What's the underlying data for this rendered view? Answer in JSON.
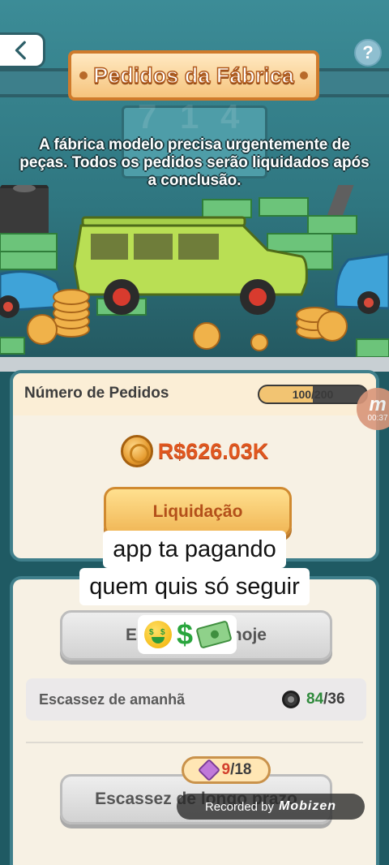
{
  "header": {
    "title": "Pedidos da Fábrica",
    "back_icon": "chevron-left-icon",
    "help_label": "?",
    "description": "A fábrica modelo precisa urgentemente de peças. Todos os pedidos serão liquidados após a conclusão."
  },
  "orders": {
    "label": "Número de Pedidos",
    "progress_text": "100/200",
    "progress_fraction": 0.5,
    "amount": "R$626.03K",
    "settle_label": "Liquidação"
  },
  "scarcity": {
    "today_label": "Escassez de hoje",
    "tomorrow_label": "Escassez de amanhã",
    "tomorrow_current": "84",
    "tomorrow_total": "/36",
    "gem_current": "9",
    "gem_total": "/18",
    "longterm_label": "Escassez de longo prazo"
  },
  "overlays": {
    "timer_letter": "m",
    "timer_text": "00:37",
    "caption_line1": "app ta pagando",
    "caption_line2": "quem quis só seguir",
    "recorder_text": "Recorded by",
    "recorder_logo": "Mobizen"
  },
  "colors": {
    "accent_orange": "#e0571f",
    "panel_border": "#3f7f8b",
    "green_count": "#2f8a3c",
    "red_count": "#d23f2c"
  }
}
